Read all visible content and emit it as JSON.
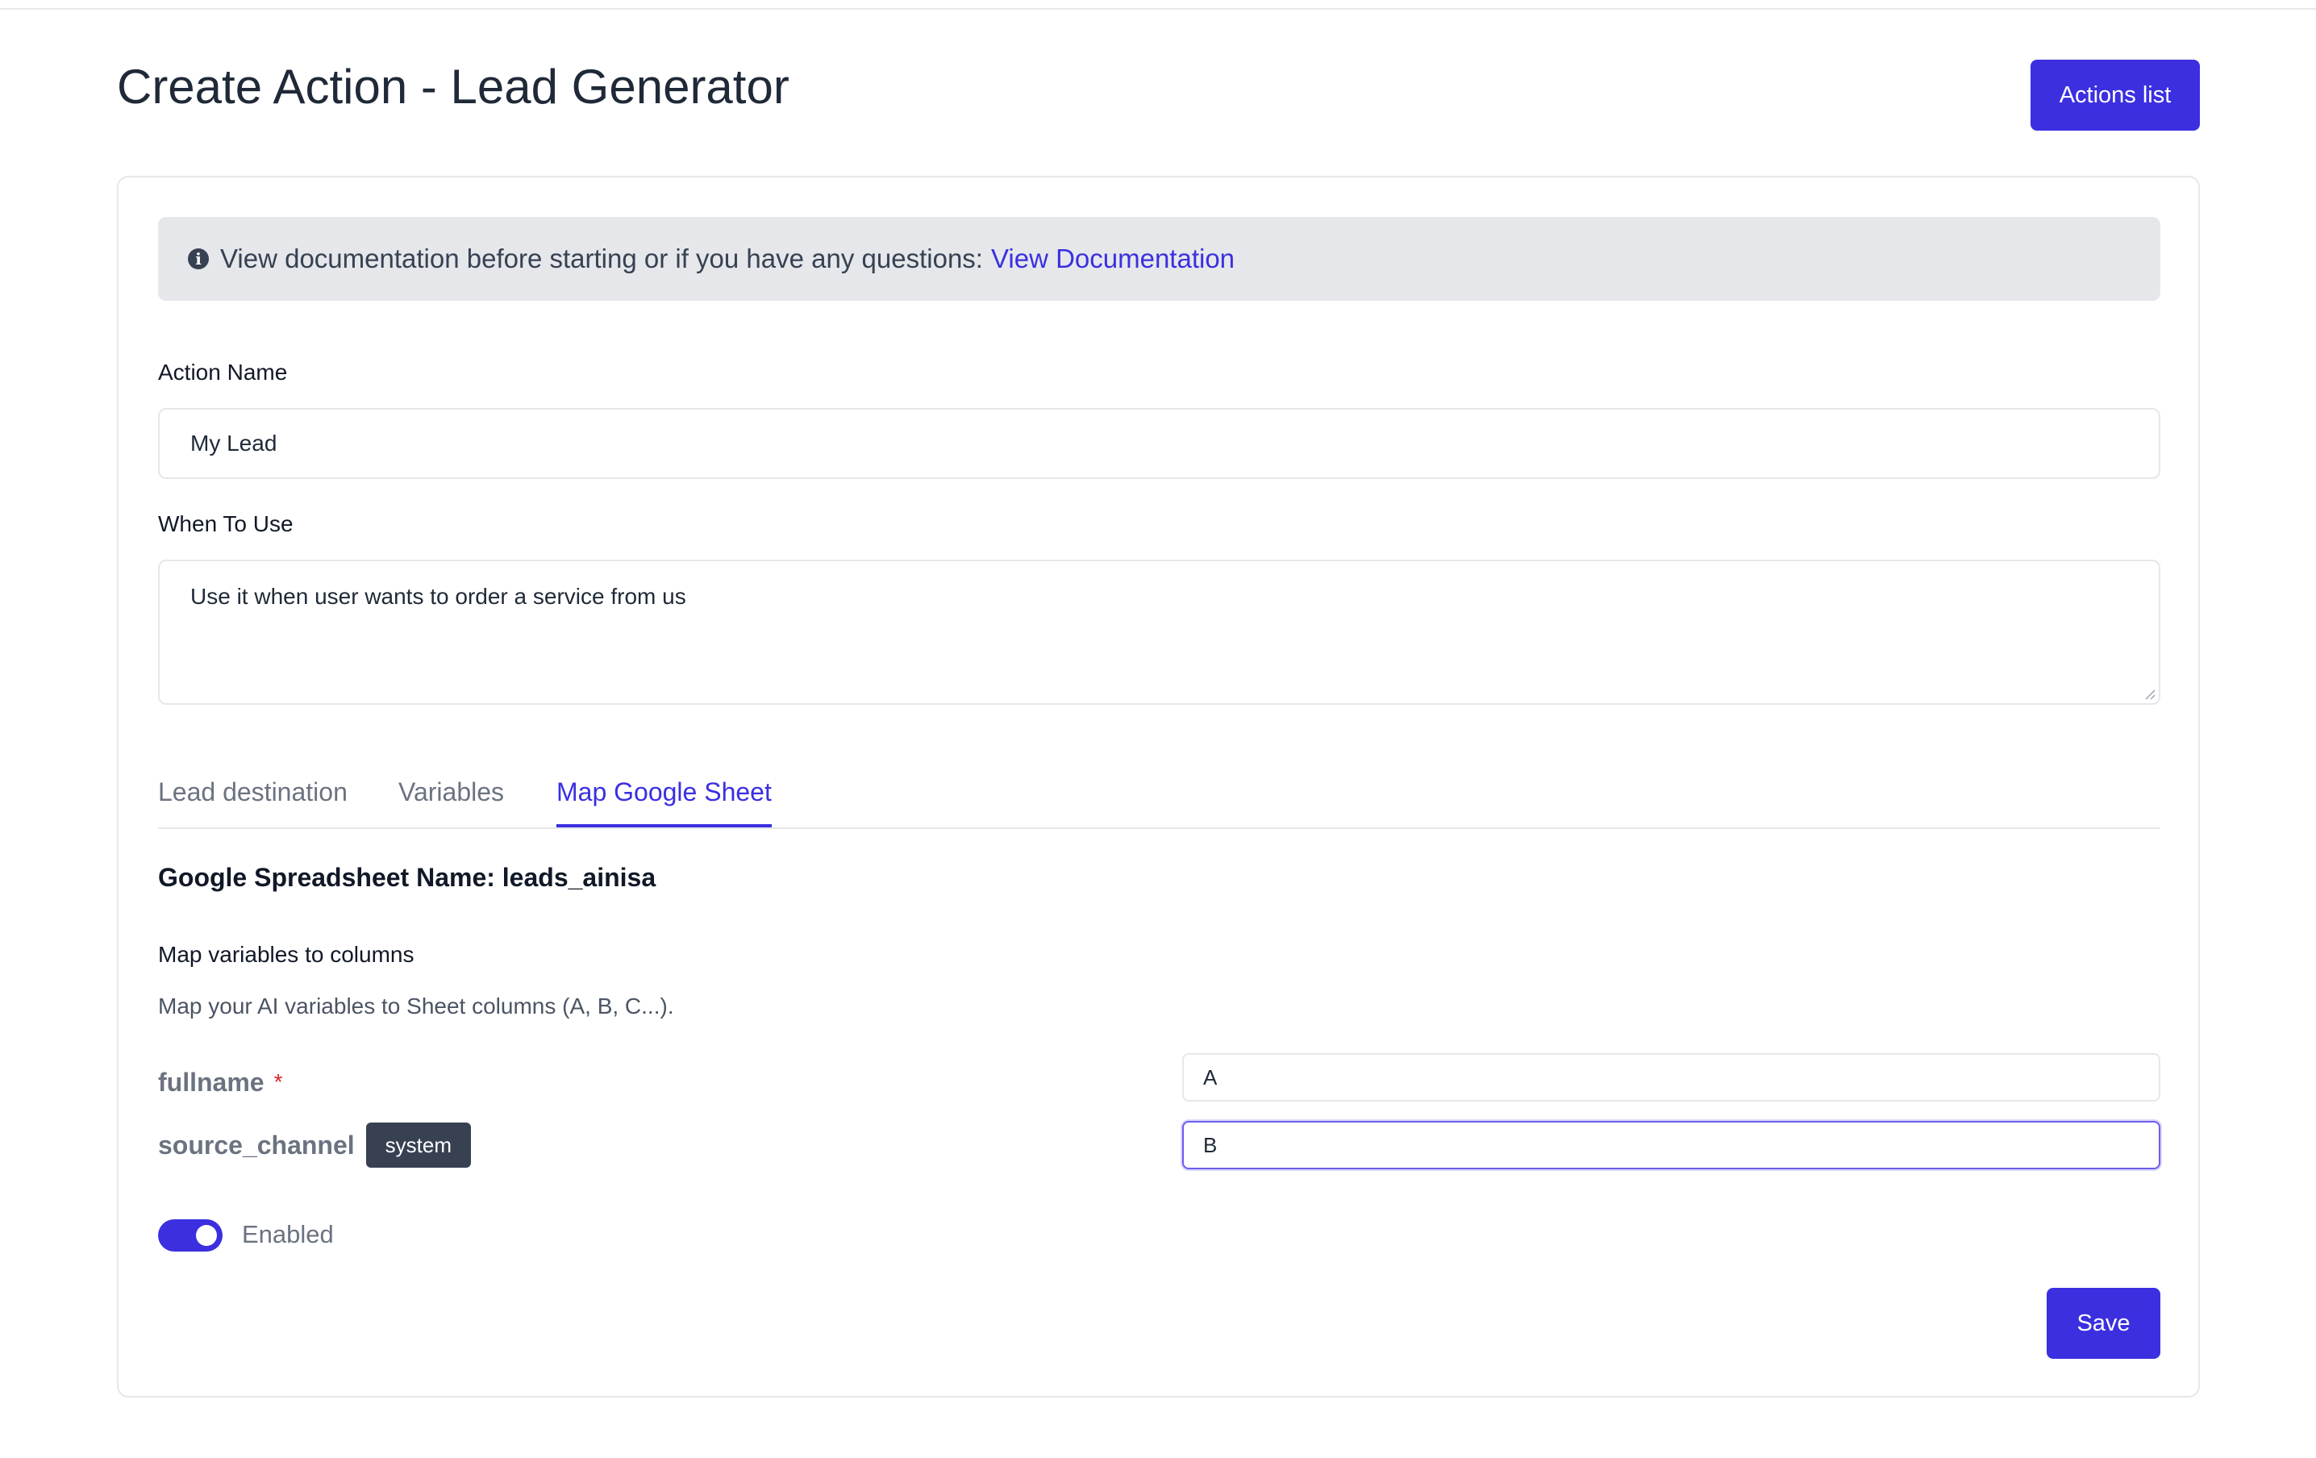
{
  "header": {
    "title": "Create Action - Lead Generator",
    "actions_list_label": "Actions list"
  },
  "info": {
    "icon": "info-circle-icon",
    "text": "View documentation before starting or if you have any questions:",
    "link_label": "View Documentation"
  },
  "form": {
    "action_name_label": "Action Name",
    "action_name_value": "My Lead",
    "when_to_use_label": "When To Use",
    "when_to_use_value": "Use it when user wants to order a service from us"
  },
  "tabs": [
    {
      "label": "Lead destination",
      "active": false
    },
    {
      "label": "Variables",
      "active": false
    },
    {
      "label": "Map Google Sheet",
      "active": true
    }
  ],
  "sheet": {
    "name_heading": "Google Spreadsheet Name: leads_ainisa",
    "map_title": "Map variables to columns",
    "map_description": "Map your AI variables to Sheet columns (A, B, C...).",
    "mappings": [
      {
        "variable": "fullname",
        "required_mark": "*",
        "column": "A"
      },
      {
        "variable": "source_channel",
        "badge": "system",
        "column": "B"
      }
    ]
  },
  "toggle": {
    "label": "Enabled",
    "on": true
  },
  "save_label": "Save",
  "colors": {
    "accent": "#3b2fe0",
    "info_bg": "#e5e7eb",
    "badge_bg": "#374151",
    "required": "#dc2626"
  }
}
